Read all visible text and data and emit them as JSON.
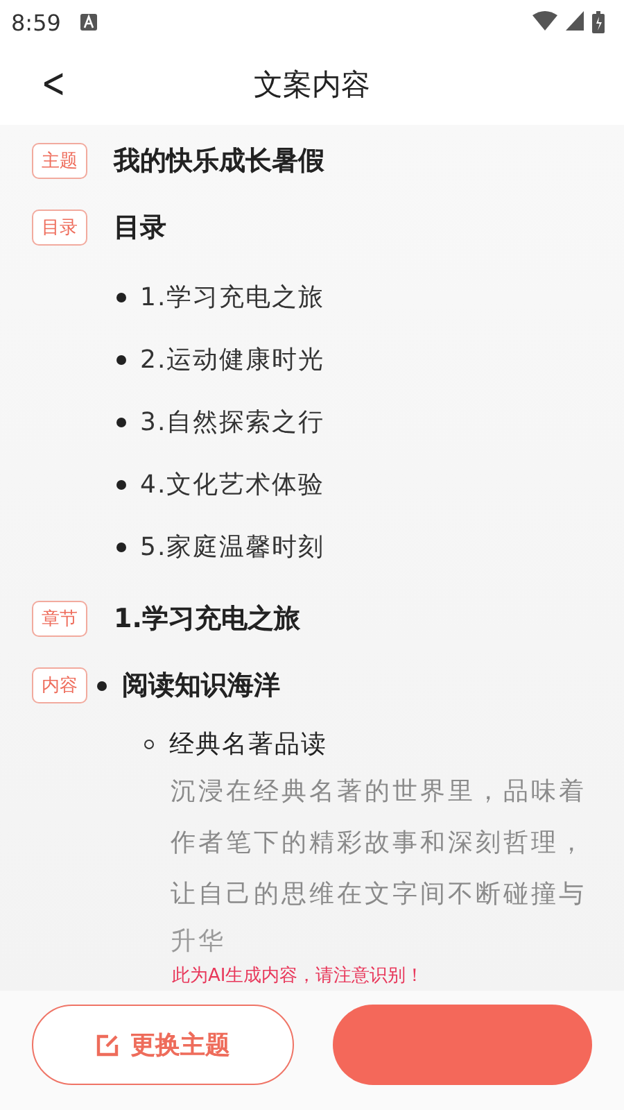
{
  "status_bar": {
    "time": "8:59"
  },
  "header": {
    "back": "<",
    "title": "文案内容"
  },
  "sections": [
    {
      "kind": "title",
      "tag": "主题",
      "text": "我的快乐成长暑假"
    },
    {
      "kind": "outline",
      "tag": "目录",
      "text": "目录",
      "items": [
        "1.学习充电之旅",
        "2.运动健康时光",
        "3.自然探索之行",
        "4.文化艺术体验",
        "5.家庭温馨时刻"
      ]
    },
    {
      "kind": "title",
      "tag": "章节",
      "text": "1.学习充电之旅"
    },
    {
      "kind": "content",
      "tag": "内容",
      "text": "阅读知识海洋",
      "children": [
        {
          "title": "经典名著品读",
          "body": "沉浸在经典名著的世界里，品味着作者笔下的精彩故事和深刻哲理，让自己的思维在文字间不断碰撞与",
          "faded": "升华"
        }
      ]
    }
  ],
  "notice": "此为AI生成内容，请注意识别！",
  "buttons": [
    {
      "kind": "outline",
      "label": "更换主题"
    },
    {
      "kind": "filled"
    }
  ]
}
